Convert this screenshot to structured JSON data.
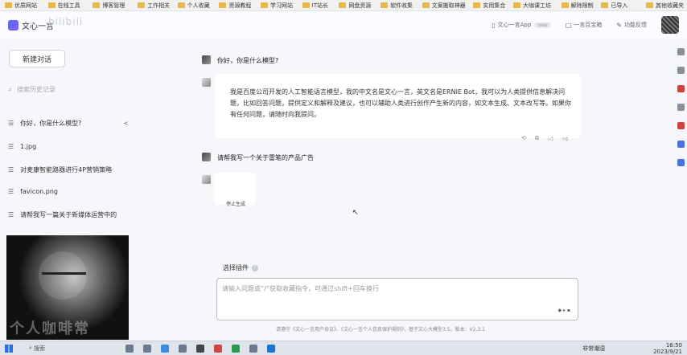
{
  "bookmarks": [
    "优质网站",
    "在线工具",
    "博客管理",
    "工作相关",
    "个人收藏",
    "资源教程",
    "学习网站",
    "IT站长",
    "网盘资源",
    "软件收集",
    "文案搬取神器",
    "实用集合",
    "大咖课工坊",
    "解除限制",
    "已导入",
    "其他收藏夹"
  ],
  "header": {
    "logo_text": "文心一言",
    "watermark": "bilibili",
    "app_link": "文心一言App",
    "app_badge": "new",
    "plugin_link": "一言百宝箱",
    "feedback_link": "功能反馈"
  },
  "sidebar": {
    "new_chat": "新建对话",
    "search_placeholder": "搜索历史记录",
    "items": [
      {
        "label": "你好，你是什么模型?"
      },
      {
        "label": "1.jpg"
      },
      {
        "label": "对麦康智能路器进行4P营销策略"
      },
      {
        "label": "favicon.png"
      },
      {
        "label": "请帮我写一篇关于新媒体运营中的"
      }
    ]
  },
  "webcam": {
    "watermark": "个人咖啡常"
  },
  "chat": {
    "messages": [
      {
        "role": "user",
        "text": "你好，你是什么模型?"
      },
      {
        "role": "assistant",
        "text": "我是百度公司开发的人工智能语言模型，我的中文名是文心一言，英文名是ERNIE Bot，我可以为人类提供信息解决问题，比如回答问题，提供定义和解释及建议，也可以辅助人类进行创作产生新的内容，如文本生成、文本改写等。如果你有任何问题，请随时向我提问。"
      },
      {
        "role": "user",
        "text": "请帮我写一个关于雷笔的产品广告"
      }
    ],
    "stop_generation": "停止生成",
    "plugins_label": "选择插件",
    "input_placeholder": "请输入问题或“/”获取收藏指令，可通过shift+回车换行",
    "footer": "请遵守《文心一言用户协议》、《文心一言个人信息保护规则》，基于文心大模型3.5，版本：V2.3.1"
  },
  "taskbar": {
    "search_label": "搜索",
    "weather": "非常潮湿",
    "time": "16:50",
    "date": "2023/9/21"
  }
}
